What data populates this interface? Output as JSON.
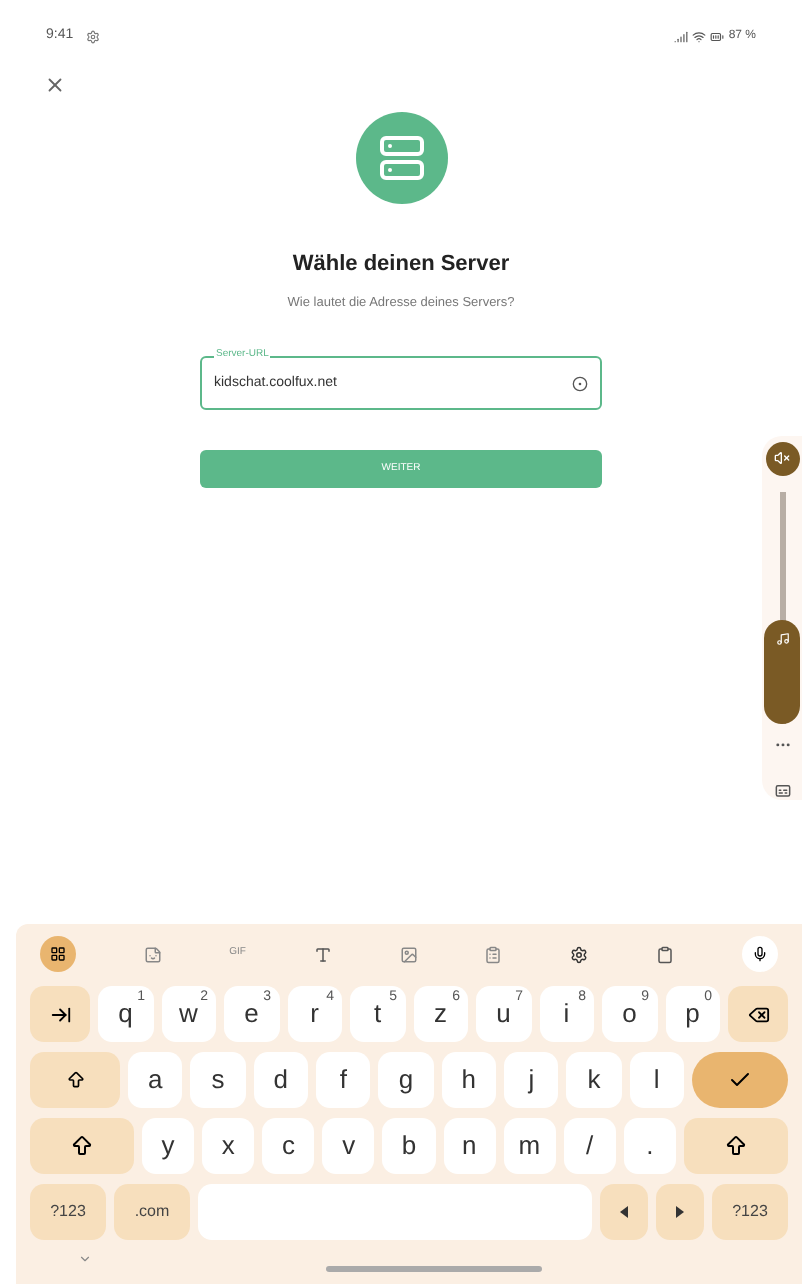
{
  "status_bar": {
    "time": "9:41",
    "battery": "87 %"
  },
  "title": "Wähle deinen Server",
  "subtitle": "Wie lautet die Adresse deines Servers?",
  "server_field": {
    "label": "Server-URL",
    "value": "kidschat.coolfux.net"
  },
  "next_button": "WEITER",
  "volume": {
    "level": 0.45
  },
  "keyboard": {
    "toolbar_text": "GIF",
    "rows": [
      [
        {
          "kind": "tab"
        },
        {
          "kind": "letter",
          "label": "q",
          "hint": "1"
        },
        {
          "kind": "letter",
          "label": "w",
          "hint": "2"
        },
        {
          "kind": "letter",
          "label": "e",
          "hint": "3"
        },
        {
          "kind": "letter",
          "label": "r",
          "hint": "4"
        },
        {
          "kind": "letter",
          "label": "t",
          "hint": "5"
        },
        {
          "kind": "letter",
          "label": "z",
          "hint": "6"
        },
        {
          "kind": "letter",
          "label": "u",
          "hint": "7"
        },
        {
          "kind": "letter",
          "label": "i",
          "hint": "8"
        },
        {
          "kind": "letter",
          "label": "o",
          "hint": "9"
        },
        {
          "kind": "letter",
          "label": "p",
          "hint": "0"
        },
        {
          "kind": "backspace"
        }
      ],
      [
        {
          "kind": "caps"
        },
        {
          "kind": "letter",
          "label": "a"
        },
        {
          "kind": "letter",
          "label": "s"
        },
        {
          "kind": "letter",
          "label": "d"
        },
        {
          "kind": "letter",
          "label": "f"
        },
        {
          "kind": "letter",
          "label": "g"
        },
        {
          "kind": "letter",
          "label": "h"
        },
        {
          "kind": "letter",
          "label": "j"
        },
        {
          "kind": "letter",
          "label": "k"
        },
        {
          "kind": "letter",
          "label": "l"
        },
        {
          "kind": "enter"
        }
      ],
      [
        {
          "kind": "shift"
        },
        {
          "kind": "letter",
          "label": "y"
        },
        {
          "kind": "letter",
          "label": "x"
        },
        {
          "kind": "letter",
          "label": "c"
        },
        {
          "kind": "letter",
          "label": "v"
        },
        {
          "kind": "letter",
          "label": "b"
        },
        {
          "kind": "letter",
          "label": "n"
        },
        {
          "kind": "letter",
          "label": "m"
        },
        {
          "kind": "letter",
          "label": "/"
        },
        {
          "kind": "letter",
          "label": "."
        },
        {
          "kind": "shift"
        }
      ],
      [
        {
          "kind": "text",
          "label": "?123"
        },
        {
          "kind": "text",
          "label": ".com"
        },
        {
          "kind": "space"
        },
        {
          "kind": "left"
        },
        {
          "kind": "right"
        },
        {
          "kind": "text",
          "label": "?123"
        }
      ]
    ]
  }
}
